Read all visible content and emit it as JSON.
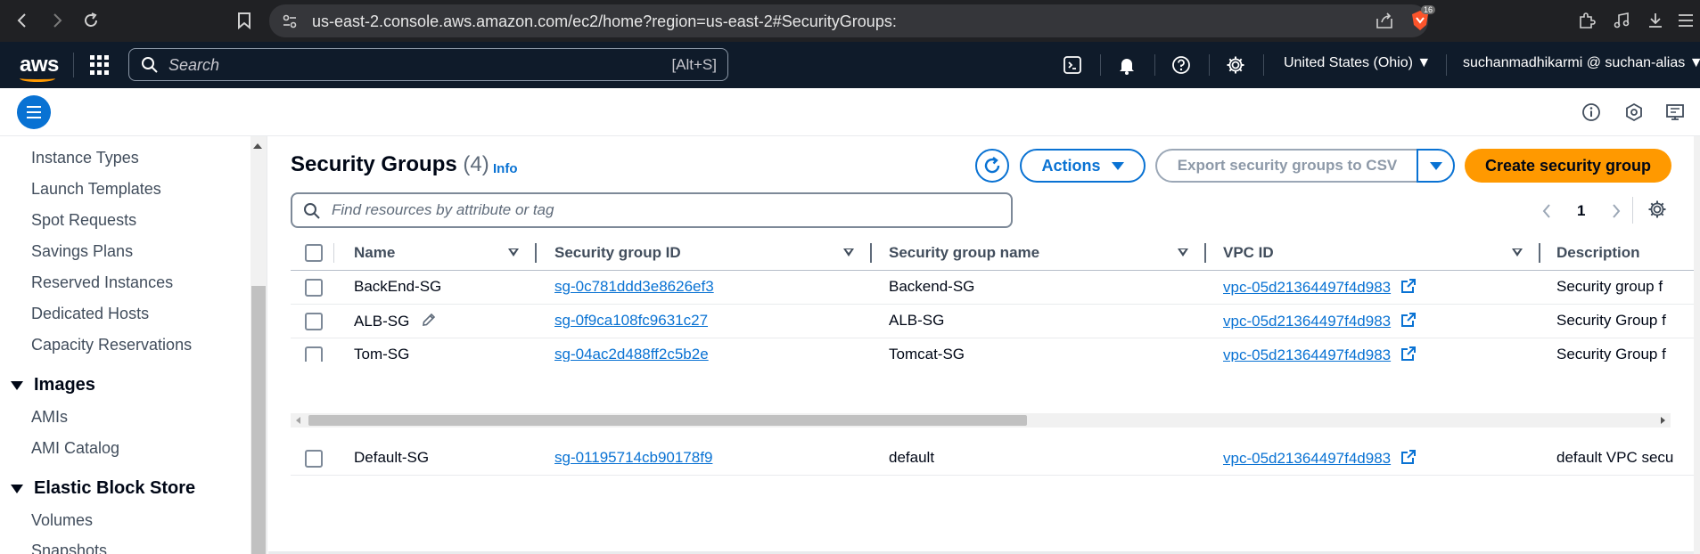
{
  "browser": {
    "url": "us-east-2.console.aws.amazon.com/ec2/home?region=us-east-2#SecurityGroups:",
    "shield_badge": "16"
  },
  "topnav": {
    "logo": "aws",
    "search_placeholder": "Search",
    "search_shortcut": "[Alt+S]",
    "region": "United States (Ohio) ▼",
    "account": "suchanmadhikarmi @ suchan-alias ▼"
  },
  "sidebar": {
    "items_top": [
      "Instance Types",
      "Launch Templates",
      "Spot Requests",
      "Savings Plans",
      "Reserved Instances",
      "Dedicated Hosts",
      "Capacity Reservations"
    ],
    "images_section": "Images",
    "images_items": [
      "AMIs",
      "AMI Catalog"
    ],
    "ebs_section": "Elastic Block Store",
    "ebs_items": [
      "Volumes",
      "Snapshots"
    ]
  },
  "main": {
    "title": "Security Groups",
    "count": "(4)",
    "info": "Info",
    "actions_label": "Actions",
    "export_label": "Export security groups to CSV",
    "create_label": "Create security group",
    "filter_placeholder": "Find resources by attribute or tag",
    "page": "1"
  },
  "table": {
    "columns": [
      "Name",
      "Security group ID",
      "Security group name",
      "VPC ID",
      "Description"
    ],
    "rows": [
      {
        "name": "BackEnd-SG",
        "id": "sg-0c781ddd3e8626ef3",
        "group_name": "Backend-SG",
        "vpc": "vpc-05d21364497f4d983",
        "desc": "Security group f"
      },
      {
        "name": "ALB-SG",
        "id": "sg-0f9ca108fc9631c27",
        "group_name": "ALB-SG",
        "vpc": "vpc-05d21364497f4d983",
        "desc": "Security Group f"
      },
      {
        "name": "Tom-SG",
        "id": "sg-04ac2d488ff2c5b2e",
        "group_name": "Tomcat-SG",
        "vpc": "vpc-05d21364497f4d983",
        "desc": "Security Group f"
      },
      {
        "name": "Default-SG",
        "id": "sg-01195714cb90178f9",
        "group_name": "default",
        "vpc": "vpc-05d21364497f4d983",
        "desc": "default VPC secu"
      }
    ]
  },
  "colors": {
    "primary": "#0972d3",
    "create": "#ff9900",
    "nav_bg": "#0f1b2a"
  }
}
